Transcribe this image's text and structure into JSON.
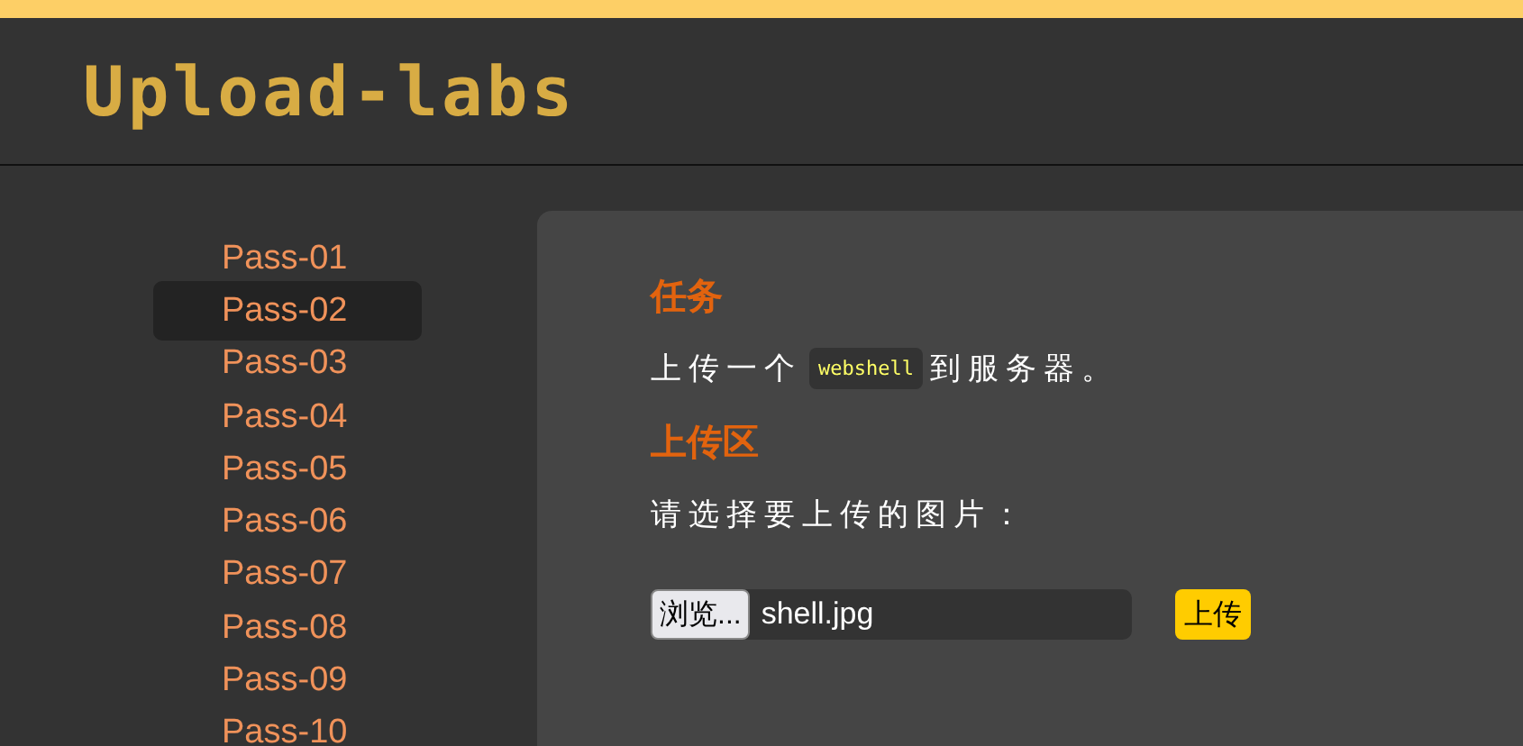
{
  "header": {
    "logo": "Upload-labs"
  },
  "sidebar": {
    "items": [
      {
        "label": "Pass-01",
        "selected": false
      },
      {
        "label": "Pass-02",
        "selected": true
      },
      {
        "label": "Pass-03",
        "selected": false
      },
      {
        "label": "Pass-04",
        "selected": false
      },
      {
        "label": "Pass-05",
        "selected": false
      },
      {
        "label": "Pass-06",
        "selected": false
      },
      {
        "label": "Pass-07",
        "selected": false
      },
      {
        "label": "Pass-08",
        "selected": false
      },
      {
        "label": "Pass-09",
        "selected": false
      },
      {
        "label": "Pass-10",
        "selected": false
      }
    ]
  },
  "task": {
    "heading": "任务",
    "before": "上传一个",
    "code": "webshell",
    "after": "到服务器。"
  },
  "upload": {
    "heading": "上传区",
    "prompt": "请选择要上传的图片：",
    "browse_button": "浏览...",
    "file_name": "shell.jpg",
    "submit_button": "上传"
  }
}
